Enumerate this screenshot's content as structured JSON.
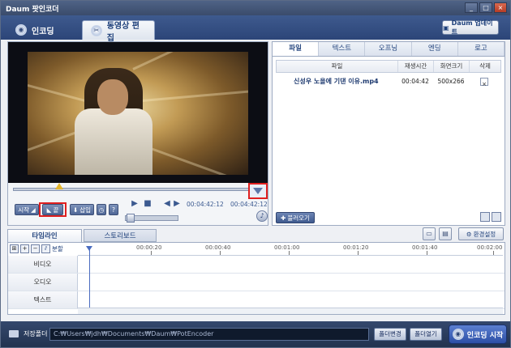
{
  "window": {
    "title": "Daum 팟인코더"
  },
  "topbar": {
    "tab_encoding": "인코딩",
    "tab_edit": "동영상 편집",
    "daum_update": "Daum 업데이트"
  },
  "player": {
    "start_label": "시작",
    "end_label": "끝",
    "insert_label": "삽입",
    "help_label": "?",
    "current_time": "00:04:42:12",
    "total_time": "00:04:42:12"
  },
  "right_panel": {
    "tabs": [
      "파일",
      "텍스트",
      "오프닝",
      "엔딩",
      "로고"
    ],
    "active_tab": "파일",
    "columns": [
      "파일",
      "재생시간",
      "화면크기",
      "삭제"
    ],
    "files": [
      {
        "name": "신성우 노을에 기댄 이유.mp4",
        "duration": "00:04:42",
        "size": "500x266",
        "delete": "×"
      }
    ],
    "load_button": "불러오기"
  },
  "timeline": {
    "tab_timeline": "타임라인",
    "tab_storyboard": "스토리보드",
    "env_settings": "환경설정",
    "split_label": "분할",
    "ruler_ticks": [
      "00:00:20",
      "00:00:40",
      "00:01:00",
      "00:01:20",
      "00:01:40",
      "00:02:00"
    ],
    "tracks": [
      "비디오",
      "오디오",
      "텍스트"
    ]
  },
  "bottombar": {
    "folder_label": "저장폴더",
    "path": "C:₩Users₩jdh₩Documents₩Daum₩PotEncoder",
    "change_folder": "폴더변경",
    "open_folder": "폴더열기",
    "start_encoding": "인코딩 시작"
  },
  "colors": {
    "accent": "#2c4578",
    "highlight": "#e02020"
  }
}
